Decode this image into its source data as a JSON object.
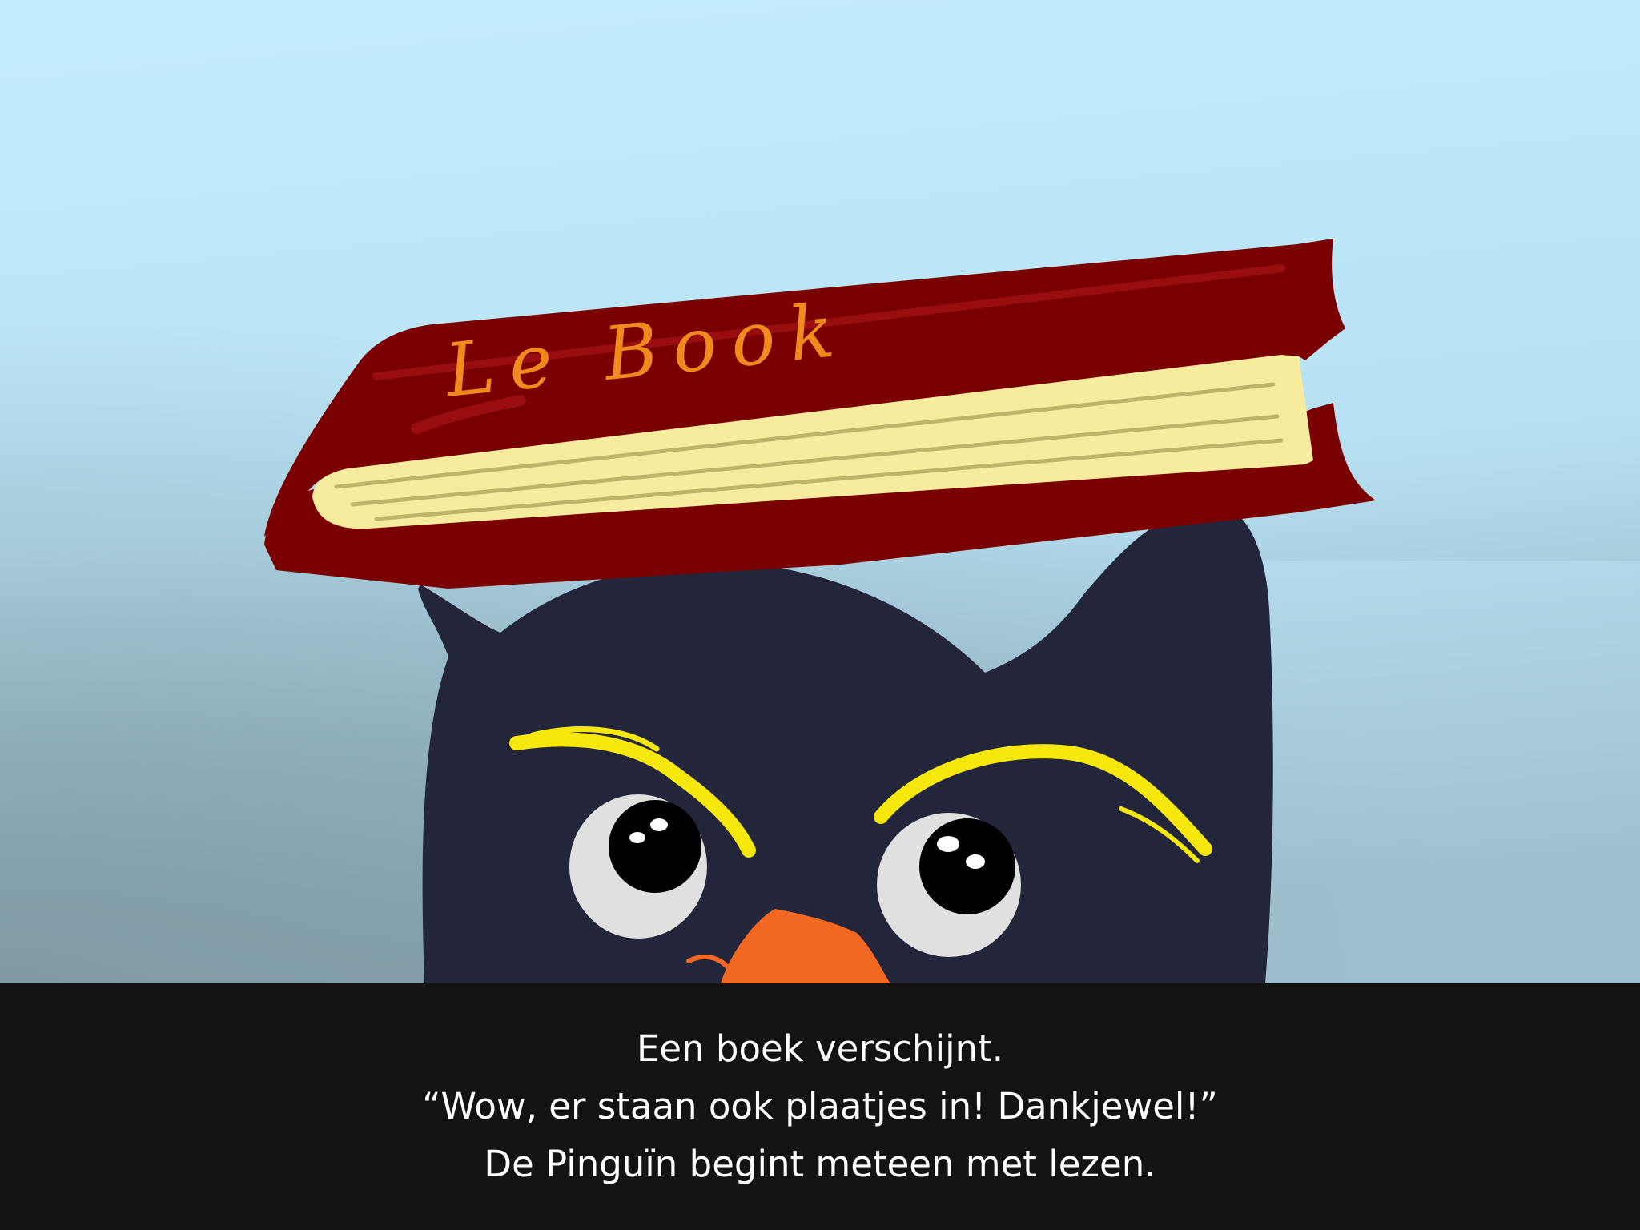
{
  "illustration": {
    "book_title": "Le Book",
    "colors": {
      "sky_top": "#c3ecfd",
      "sky_left_bottom": "#86a3b0",
      "book_cover": "#7a0000",
      "book_pages": "#f7ec9e",
      "book_lettering": "#f08a1e",
      "penguin_body": "#23253a",
      "eyebrows": "#f6e80c",
      "eye_white": "#e0e0e0",
      "beak": "#f26722"
    }
  },
  "caption": {
    "line1": "Een boek verschijnt.",
    "line2": "“Wow, er staan ook plaatjes in! Dankjewel!”",
    "line3": "De Pinguïn begint meteen met lezen."
  }
}
